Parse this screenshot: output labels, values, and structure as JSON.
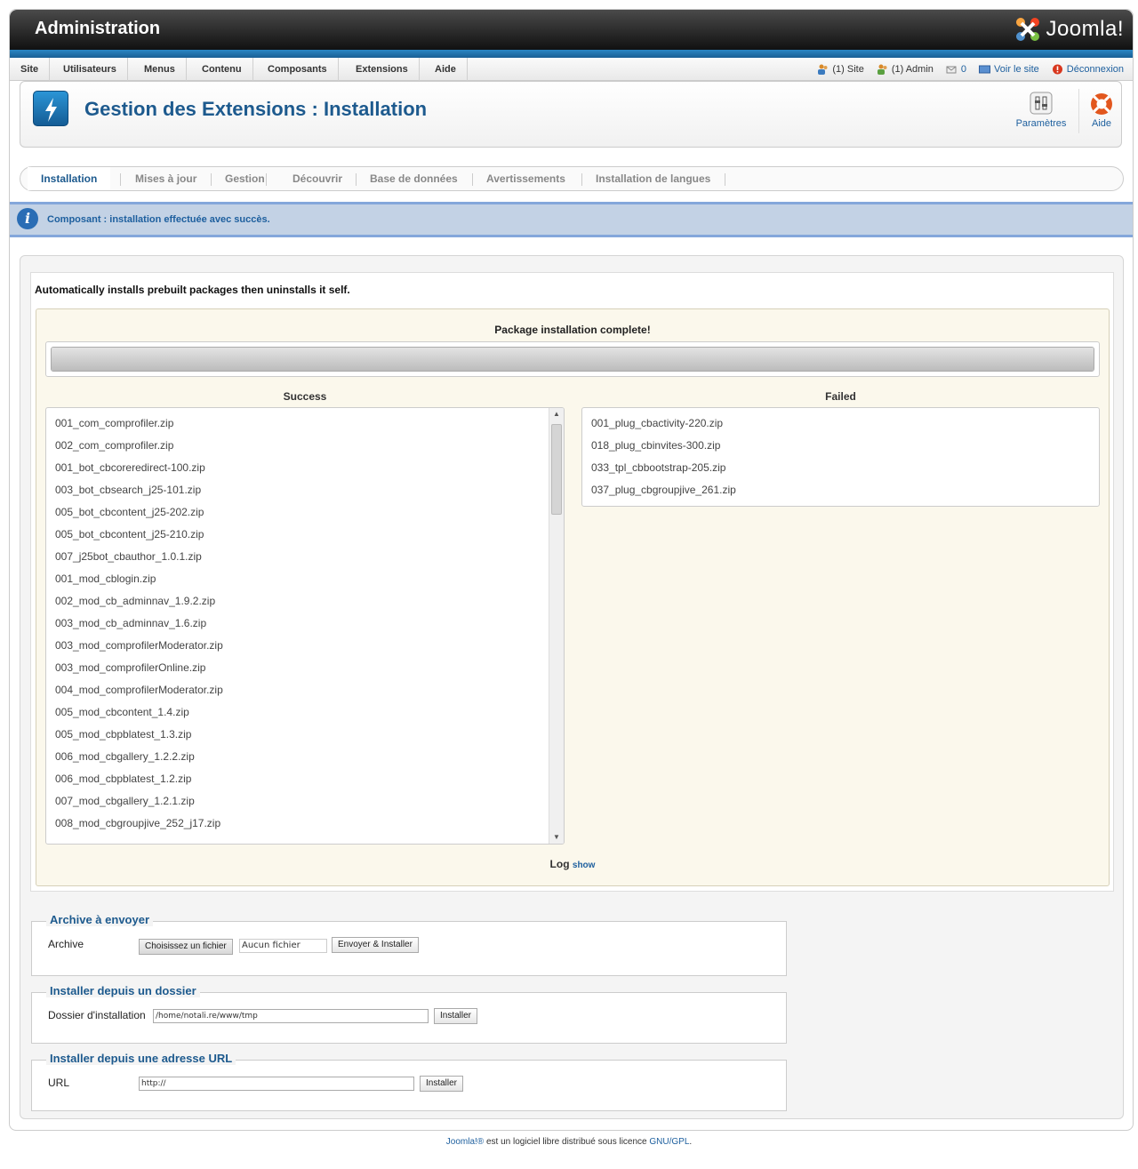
{
  "header": {
    "title": "Administration",
    "logo_text": "Joomla!"
  },
  "menu": {
    "items": [
      "Site",
      "Utilisateurs",
      "Menus",
      "Contenu",
      "Composants",
      "Extensions",
      "Aide"
    ]
  },
  "status": {
    "site": "(1) Site",
    "admin": "(1) Admin",
    "messages": "0",
    "view_site": "Voir le site",
    "logout": "Déconnexion"
  },
  "toolbar": {
    "page_title": "Gestion des Extensions : Installation",
    "options_label": "Paramètres",
    "help_label": "Aide"
  },
  "submenu": {
    "items": [
      "Installation",
      "Mises à jour",
      "Gestion",
      "Découvrir",
      "Base de données",
      "Avertissements",
      "Installation de langues"
    ],
    "active": "Installation"
  },
  "message": {
    "text": "Composant : installation effectuée avec succès."
  },
  "installer": {
    "description": "Automatically installs prebuilt packages then uninstalls it self.",
    "status": "Package installation complete!",
    "progress": 1.0,
    "success_heading": "Success",
    "failed_heading": "Failed",
    "success_items": [
      "001_com_comprofiler.zip",
      "002_com_comprofiler.zip",
      "001_bot_cbcoreredirect-100.zip",
      "003_bot_cbsearch_j25-101.zip",
      "005_bot_cbcontent_j25-202.zip",
      "005_bot_cbcontent_j25-210.zip",
      "007_j25bot_cbauthor_1.0.1.zip",
      "001_mod_cblogin.zip",
      "002_mod_cb_adminnav_1.9.2.zip",
      "003_mod_cb_adminnav_1.6.zip",
      "003_mod_comprofilerModerator.zip",
      "003_mod_comprofilerOnline.zip",
      "004_mod_comprofilerModerator.zip",
      "005_mod_cbcontent_1.4.zip",
      "005_mod_cbpblatest_1.3.zip",
      "006_mod_cbgallery_1.2.2.zip",
      "006_mod_cbpblatest_1.2.zip",
      "007_mod_cbgallery_1.2.1.zip",
      "008_mod_cbgroupjive_252_j17.zip"
    ],
    "failed_items": [
      "001_plug_cbactivity-220.zip",
      "018_plug_cbinvites-300.zip",
      "033_tpl_cbbootstrap-205.zip",
      "037_plug_cbgroupjive_261.zip"
    ],
    "log_label": "Log",
    "log_toggle": "show"
  },
  "upload": {
    "legend": "Archive à envoyer",
    "label": "Archive",
    "choose_button": "Choisissez un fichier",
    "no_file": "Aucun fichier choisi",
    "submit": "Envoyer & Installer"
  },
  "directory": {
    "legend": "Installer depuis un dossier",
    "label": "Dossier d'installation",
    "value": "/home/notali.re/www/tmp",
    "submit": "Installer"
  },
  "url": {
    "legend": "Installer depuis une adresse URL",
    "label": "URL",
    "value": "http://",
    "submit": "Installer"
  },
  "footer": {
    "brand": "Joomla!®",
    "text": " est un logiciel libre distribué sous licence ",
    "license": "GNU/GPL",
    "end": "."
  },
  "colors": {
    "header_dark": "#111111",
    "accent_blue": "#1d5a8e",
    "message_bg": "#c3d2e5",
    "installer_bg": "#fbf8ec"
  }
}
